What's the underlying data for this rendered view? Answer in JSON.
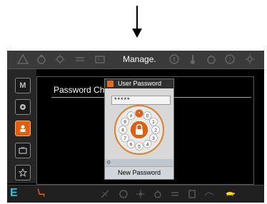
{
  "header": {
    "title": "Manage."
  },
  "content": {
    "section_label": "Password Cha"
  },
  "sidebar": {
    "m_label": "M",
    "e_label": "E"
  },
  "dialog": {
    "title": "User Password",
    "password_mask": "*****",
    "keys": [
      "0",
      "1",
      "2",
      "3",
      "4",
      "5",
      "6",
      "7",
      "8",
      "9"
    ],
    "center_key": "*",
    "hash_key": "#",
    "new_password_label": "New Password"
  },
  "colors": {
    "accent": "#e06010",
    "cyan": "#22c7e0",
    "highlight": "#ffe000"
  }
}
